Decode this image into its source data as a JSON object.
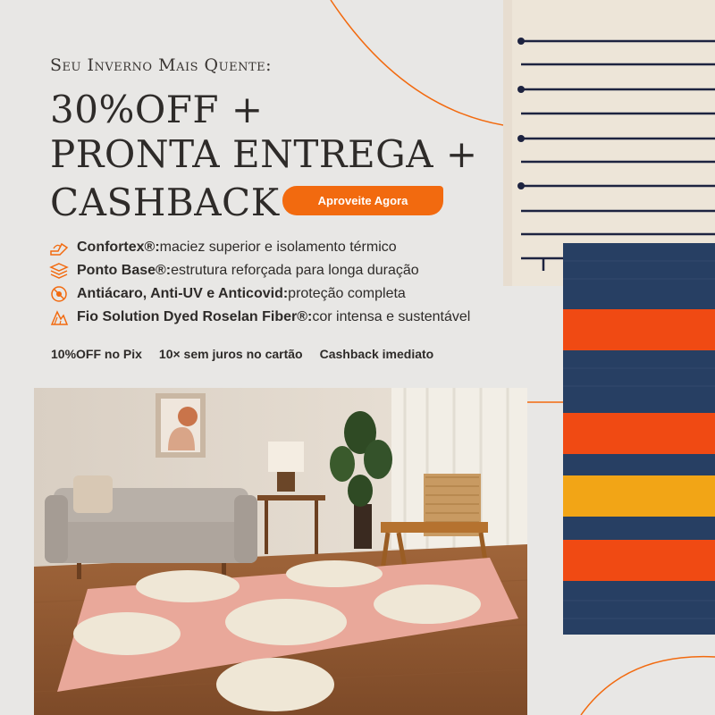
{
  "promo": {
    "kicker": "Seu Inverno Mais Quente:",
    "headline_1": "30%OFF +",
    "headline_2": "PRONTA ENTREGA +",
    "headline_3": "CASHBACK",
    "cta_label": "Aproveite Agora"
  },
  "features": [
    {
      "icon": "fabric-hand-icon",
      "title": "Confortex®:",
      "text": " maciez superior e isolamento térmico"
    },
    {
      "icon": "layers-base-icon",
      "title": "Ponto Base®:",
      "text": " estrutura reforçada para longa duração"
    },
    {
      "icon": "shield-mite-icon",
      "title": "Antiácaro, Anti-UV e Anticovid:",
      "text": " proteção completa"
    },
    {
      "icon": "yarn-fiber-icon",
      "title": "Fio Solution Dyed Roselan Fiber®:",
      "text": " cor intensa e sustentável"
    }
  ],
  "perks": [
    "10%OFF no Pix",
    "10× sem juros no cartão",
    "Cashback imediato"
  ],
  "colors": {
    "accent": "#f26a0f",
    "background": "#e8e7e5",
    "text": "#2e2b29",
    "rug_navy": "#273f63",
    "rug_orange": "#f04a13",
    "rug_yellow": "#f2a516",
    "rug_pink": "#e9a89a",
    "rug_cream": "#efe7d6"
  }
}
